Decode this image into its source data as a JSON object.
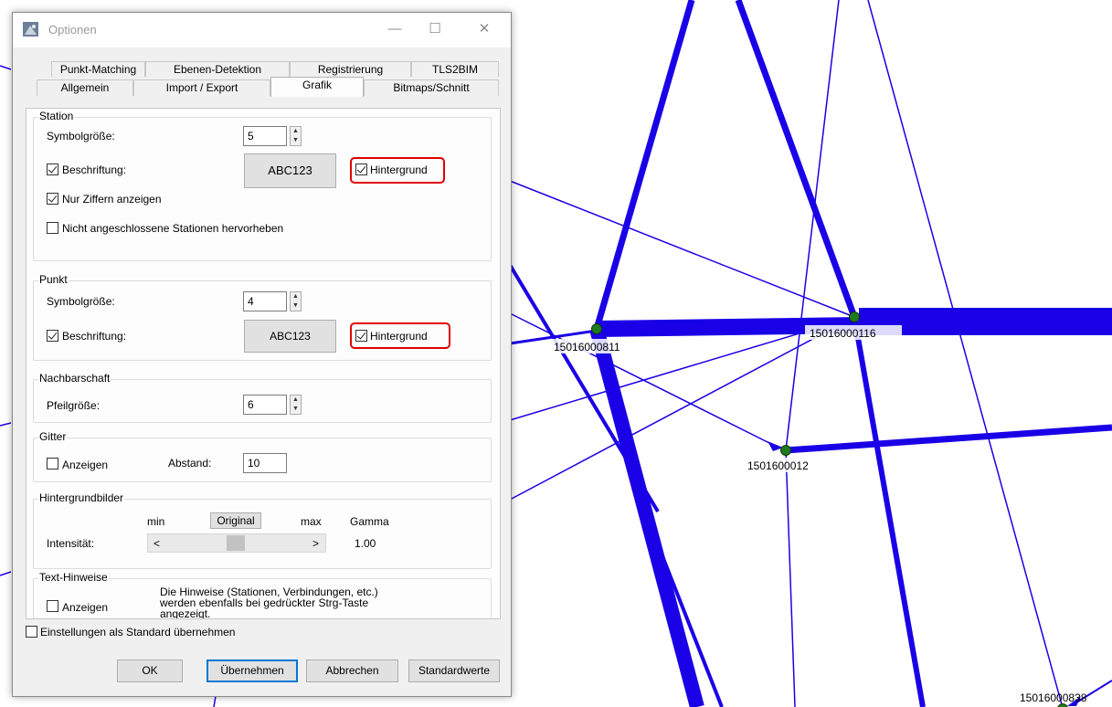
{
  "network": {
    "nodes": [
      {
        "label": "15016000811"
      },
      {
        "label": "15016000116"
      },
      {
        "label": "1501600012"
      },
      {
        "label": "15016000838"
      }
    ],
    "line_color": "#1a00e6",
    "node_color": "#1f7a1f"
  },
  "dialog": {
    "title": "Optionen",
    "window_controls": {
      "minimize": "—",
      "maximize": "☐",
      "close": "✕"
    },
    "tabs_row1": [
      "Punkt-Matching",
      "Ebenen-Detektion",
      "Registrierung",
      "TLS2BIM"
    ],
    "tabs_row2": [
      "Allgemein",
      "Import / Export",
      "Grafik",
      "Bitmaps/Schnitt"
    ],
    "active_tab": "Grafik",
    "station": {
      "title": "Station",
      "symbol_label": "Symbolgröße:",
      "symbol_value": "5",
      "caption_label": "Beschriftung:",
      "caption_checked": true,
      "font_button": "ABC123",
      "background_label": "Hintergrund",
      "background_checked": true,
      "digits_only_label": "Nur Ziffern anzeigen",
      "digits_only_checked": true,
      "highlight_label": "Nicht angeschlossene Stationen hervorheben",
      "highlight_checked": false
    },
    "punkt": {
      "title": "Punkt",
      "symbol_label": "Symbolgröße:",
      "symbol_value": "4",
      "caption_label": "Beschriftung:",
      "caption_checked": true,
      "font_button": "ABC123",
      "background_label": "Hintergrund",
      "background_checked": true
    },
    "nachbarschaft": {
      "title": "Nachbarschaft",
      "arrow_label": "Pfeilgröße:",
      "arrow_value": "6"
    },
    "gitter": {
      "title": "Gitter",
      "show_label": "Anzeigen",
      "show_checked": false,
      "distance_label": "Abstand:",
      "distance_value": "10"
    },
    "hintergrundbilder": {
      "title": "Hintergrundbilder",
      "min_label": "min",
      "original_button": "Original",
      "max_label": "max",
      "gamma_label": "Gamma",
      "intensity_label": "Intensität:",
      "left_arrow": "<",
      "right_arrow": ">",
      "gamma_value": "1.00"
    },
    "texthinweise": {
      "title": "Text-Hinweise",
      "show_label": "Anzeigen",
      "show_checked": false,
      "description": "Die Hinweise (Stationen, Verbindungen, etc.) werden ebenfalls bei gedrückter Strg-Taste angezeigt."
    },
    "default_settings_label": "Einstellungen als Standard übernehmen",
    "default_settings_checked": false,
    "buttons": {
      "ok": "OK",
      "apply": "Übernehmen",
      "cancel": "Abbrechen",
      "defaults": "Standardwerte"
    }
  }
}
